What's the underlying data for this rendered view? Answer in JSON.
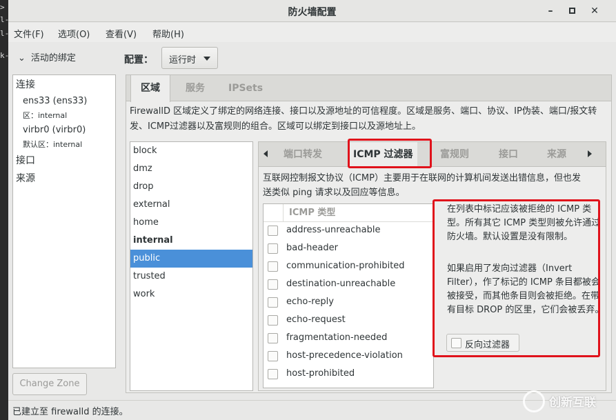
{
  "window": {
    "title": "防火墙配置"
  },
  "menu": [
    "文件(F)",
    "选项(O)",
    "查看(V)",
    "帮助(H)"
  ],
  "sidebar": {
    "header": "活动的绑定",
    "sections": {
      "connections": "连接",
      "interfaces": "接口",
      "sources": "来源"
    },
    "connections": [
      {
        "name": "ens33 (ens33)",
        "zone": "区：internal"
      },
      {
        "name": "virbr0 (virbr0)",
        "zone": "默认区：internal"
      }
    ],
    "change_zone": "Change Zone"
  },
  "config": {
    "label": "配置：",
    "value": "运行时"
  },
  "main_tabs": [
    "区域",
    "服务",
    "IPSets"
  ],
  "zone_description": "FirewallD 区域定义了绑定的网络连接、接口以及源地址的可信程度。区域是服务、端口、协议、IP伪装、端口/报文转发、ICMP过滤器以及富规则的组合。区域可以绑定到接口以及源地址上。",
  "zones": [
    "block",
    "dmz",
    "drop",
    "external",
    "home",
    "internal",
    "public",
    "trusted",
    "work"
  ],
  "selected_zone": "public",
  "default_zone": "internal",
  "sub_tabs": [
    "端口转发",
    "ICMP 过滤器",
    "富规则",
    "接口",
    "来源"
  ],
  "icmp": {
    "description": "互联网控制报文协议（ICMP）主要用于在联网的计算机间发送出错信息，但也发送类似 ping 请求以及回应等信息。",
    "column": "ICMP 类型",
    "types": [
      "address-unreachable",
      "bad-header",
      "communication-prohibited",
      "destination-unreachable",
      "echo-reply",
      "echo-request",
      "fragmentation-needed",
      "host-precedence-violation",
      "host-prohibited"
    ],
    "help1": "在列表中标记应该被拒绝的 ICMP 类型。所有其它 ICMP 类型则被允许通过防火墙。默认设置是没有限制。",
    "help2": "如果启用了发向过滤器（Invert Filter），作了标记的 ICMP 条目都被会被接受，而其他条目则会被拒绝。在带有目标 DROP 的区里，它们会被丢弃。",
    "invert_label": "反向过滤器"
  },
  "status": "已建立至 firewalld 的连接。",
  "watermark": "创新互联",
  "colors": {
    "selection": "#4a90d9",
    "highlight": "#e0121b"
  }
}
